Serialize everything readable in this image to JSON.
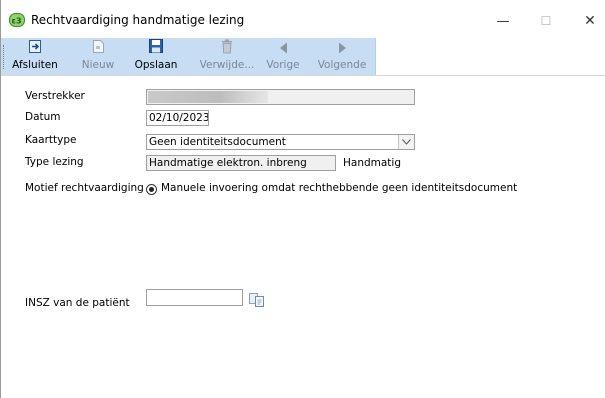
{
  "window": {
    "title": "Rechtvaardiging handmatige lezing",
    "app_icon": "app-logo-icon",
    "controls": {
      "minimize": "—",
      "maximize": "☐",
      "close": "✕"
    }
  },
  "toolbar": {
    "buttons": [
      {
        "label": "Afsluiten",
        "icon": "exit-icon",
        "enabled": true
      },
      {
        "label": "Nieuw",
        "icon": "new-document-icon",
        "enabled": false
      },
      {
        "label": "Opslaan",
        "icon": "save-icon",
        "enabled": true
      },
      {
        "label": "Verwijde...",
        "icon": "trash-icon",
        "enabled": false
      },
      {
        "label": "Vorige",
        "icon": "previous-icon",
        "enabled": false
      },
      {
        "label": "Volgende",
        "icon": "next-icon",
        "enabled": false
      }
    ]
  },
  "form": {
    "verstrekker": {
      "label": "Verstrekker",
      "value": ""
    },
    "datum": {
      "label": "Datum",
      "value": "02/10/2023"
    },
    "kaarttype": {
      "label": "Kaarttype",
      "value": "Geen identiteitsdocument"
    },
    "type_lezing": {
      "label": "Type lezing",
      "value": "Handmatige elektron. inbreng",
      "extra": "Handmatig"
    },
    "motief": {
      "label": "Motief rechtvaardiging",
      "option": "Manuele invoering omdat rechthebbende geen identiteitsdocument"
    },
    "insz": {
      "label": "INSZ van de patiënt",
      "value": ""
    }
  },
  "colors": {
    "toolbar_bg": "#c7ddf4",
    "disabled_text": "#7d8793"
  }
}
